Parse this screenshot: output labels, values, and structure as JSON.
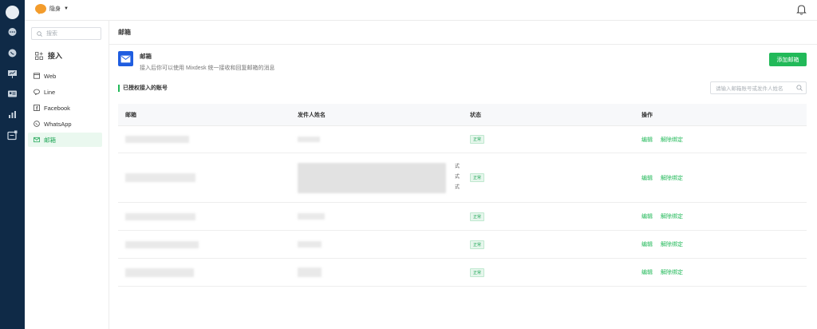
{
  "topbar": {
    "status_label": "隐身"
  },
  "sidebar": {
    "search_placeholder": "搜索",
    "section_title": "接入",
    "items": [
      {
        "label": "Web",
        "icon": "window-icon"
      },
      {
        "label": "Line",
        "icon": "line-icon"
      },
      {
        "label": "Facebook",
        "icon": "facebook-icon"
      },
      {
        "label": "WhatsApp",
        "icon": "whatsapp-icon"
      },
      {
        "label": "邮箱",
        "icon": "mail-icon",
        "active": true
      }
    ]
  },
  "main": {
    "title": "邮箱",
    "channel": {
      "name": "邮箱",
      "description": "接入后你可以使用 Mixdesk 统一接收和回复邮箱的消息"
    },
    "add_button": "添加邮箱",
    "section_label": "已授权接入的账号",
    "table_search_placeholder": "请输入邮箱账号或发件人姓名",
    "table": {
      "columns": [
        "邮箱",
        "发件人姓名",
        "状态",
        "操作"
      ],
      "rows": [
        {
          "status": "正常",
          "actions": [
            "编辑",
            "解除绑定"
          ],
          "side_marks": []
        },
        {
          "status": "正常",
          "actions": [
            "编辑",
            "解除绑定"
          ],
          "side_marks": [
            "式",
            "式",
            "式"
          ]
        },
        {
          "status": "正常",
          "actions": [
            "编辑",
            "解除绑定"
          ],
          "side_marks": []
        },
        {
          "status": "正常",
          "actions": [
            "编辑",
            "解除绑定"
          ],
          "side_marks": []
        },
        {
          "status": "正常",
          "actions": [
            "编辑",
            "解除绑定"
          ],
          "side_marks": []
        }
      ]
    }
  },
  "colors": {
    "rail": "#0f2a47",
    "accent": "#22b959",
    "mail_badge": "#1f5de0",
    "status_dot": "#f39c2c"
  }
}
